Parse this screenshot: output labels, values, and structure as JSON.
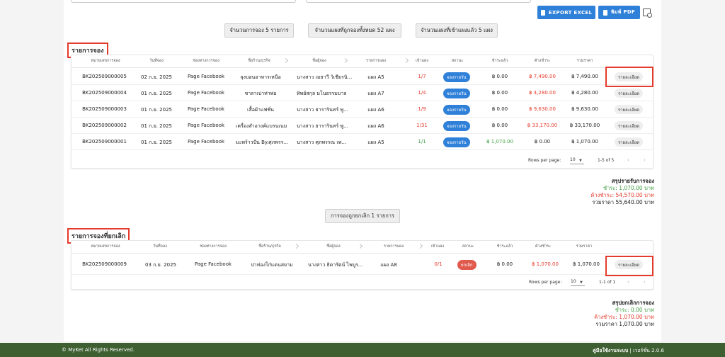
{
  "toolbar": {
    "export_excel": "EXPORT EXCEL",
    "print_pdf": "พิมพ์ PDF"
  },
  "summary_buttons": [
    "จำนวนการจอง 5 รายการ",
    "จำนวนแผงที่ถูกจองทั้งหมด 52 แผง",
    "จำนวนแผงที่เข้าแผงแล้ว 5 แผง"
  ],
  "bookings": {
    "title": "รายการจอง",
    "headers": [
      "หมายเลขการจอง",
      "วันที่จอง",
      "ช่องทางการจอง",
      "ชื่อร้าน/ธุรกิจ",
      "ชื่อผู้จอง",
      "รายการแผง",
      "เข้าแผง",
      "สถานะ",
      "ชำระแล้ว",
      "ค้างชำระ",
      "รวมราคา"
    ],
    "rows": [
      {
        "id": "BK202509000005",
        "date": "02 ก.ย. 2025",
        "channel": "Page Facebook",
        "shop": "ลุงบอนอาหารเหนือ",
        "booker": "นางสาว เมธาวี วิเชียรนิ...",
        "stall": "แผง A5",
        "checkin": "1/7",
        "status": "จองรายวัน",
        "paid": "฿ 0.00",
        "owe": "฿ 7,490.00",
        "total": "฿ 7,490.00",
        "detail": "รายละเอียด"
      },
      {
        "id": "BK202509000004",
        "date": "01 ก.ย. 2025",
        "channel": "Page Facebook",
        "shop": "ชาลาเปาท่าพ่อ",
        "booker": "ทิพย์สกุล มโนธรรมบาล",
        "stall": "แผง A7",
        "checkin": "1/4",
        "status": "จองรายวัน",
        "paid": "฿ 0.00",
        "owe": "฿ 4,280.00",
        "total": "฿ 4,280.00",
        "detail": "รายละเอียด"
      },
      {
        "id": "BK202509000003",
        "date": "01 ก.ย. 2025",
        "channel": "Page Facebook",
        "shop": "เสื้อผ้าแฟชั่น",
        "booker": "นางสาว ธารารินทร์ พู...",
        "stall": "แผง A6",
        "checkin": "1/9",
        "status": "จองรายวัน",
        "paid": "฿ 0.00",
        "owe": "฿ 9,630.00",
        "total": "฿ 9,630.00",
        "detail": "รายละเอียด"
      },
      {
        "id": "BK202509000002",
        "date": "01 ก.ย. 2025",
        "channel": "Page Facebook",
        "shop": "เครื่องสำอางค์แบรนเนม",
        "booker": "นางสาว ธารารินทร์ พู...",
        "stall": "แผง A6",
        "checkin": "1/31",
        "status": "จองรายวัน",
        "paid": "฿ 0.00",
        "owe": "฿ 33,170.00",
        "total": "฿ 33,170.00",
        "detail": "รายละเอียด"
      },
      {
        "id": "BK202509000001",
        "date": "01 ก.ย. 2025",
        "channel": "Page Facebook",
        "shop": "มะพร้าวปั่น By.ศุภพรร...",
        "booker": "นางสาว ศุภพรรณ เพ...",
        "stall": "แผง A5",
        "checkin": "1/1",
        "status": "จองรายวัน",
        "paid": "฿ 1,070.00",
        "owe": "฿ 0.00",
        "total": "฿ 1,070.00",
        "detail": "รายละเอียด"
      }
    ],
    "pager": {
      "rows_label": "Rows per page:",
      "rows_value": "10",
      "range": "1-5 of 5"
    },
    "totals": {
      "heading": "สรุปรายรับการจอง",
      "paid": "ชำระ: 1,070.00 บาท",
      "owe": "ค้างชำระ: 54,570.00 บาท",
      "sum": "รวมราคา 55,640.00 บาท"
    }
  },
  "cancelled_button": "การจองถูกยกเลิก 1 รายการ",
  "cancelled": {
    "title": "รายการจองที่ยกเลิก",
    "headers": [
      "หมายเลขการจอง",
      "วันที่จอง",
      "ช่องทางการจอง",
      "ชื่อร้าน/ธุรกิจ",
      "ชื่อผู้จอง",
      "รายการแผง",
      "เข้าแผง",
      "สถานะ",
      "ชำระแล้ว",
      "ค้างชำระ",
      "รวมราคา"
    ],
    "rows": [
      {
        "id": "BK202509000009",
        "date": "03 ก.ย. 2025",
        "channel": "Page Facebook",
        "shop": "ปาท่องโก๋แดนสยาม",
        "booker": "นางสาว ธิดารัตน์ ไพบูร...",
        "stall": "แผง A8",
        "checkin": "0/1",
        "status": "ยกเลิก",
        "paid": "฿ 0.00",
        "owe": "฿ 1,070.00",
        "total": "฿ 1,070.00",
        "detail": "รายละเอียด"
      }
    ],
    "pager": {
      "rows_label": "Rows per page:",
      "rows_value": "10",
      "range": "1-1 of 1"
    },
    "totals": {
      "heading": "สรุปยกเลิกการจอง",
      "paid": "ชำระ: 0.00 บาท",
      "owe": "ค้างชำระ: 1,070.00 บาท",
      "sum": "รวมราคา 1,070.00 บาท"
    }
  },
  "footer": {
    "copyright": "© MyKet All Rights Reserved.",
    "manual": "คู่มือใช้งานระบบ",
    "version": "| เวอร์ชั่น 2.0.6"
  },
  "colors": {
    "accent": "#2f80d8",
    "danger": "#e53b2c",
    "success": "#43a047",
    "footer": "#3e5f32"
  }
}
